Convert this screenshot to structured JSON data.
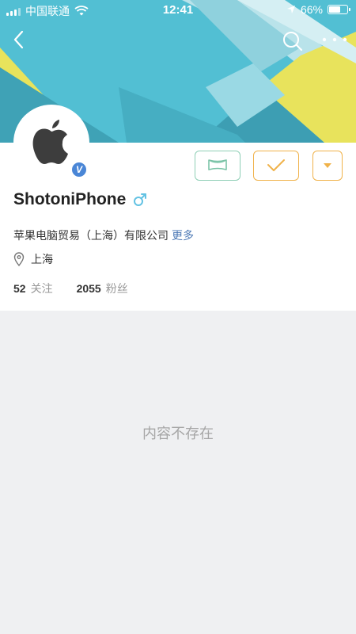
{
  "status_bar": {
    "carrier": "中国联通",
    "time": "12:41",
    "battery_percent_text": "66%",
    "battery_level": 0.66
  },
  "nav": {
    "back_icon": "chevron-left-icon",
    "search_icon": "search-icon",
    "more_icon": "more-dots-icon"
  },
  "profile": {
    "name": "ShotoniPhone",
    "gender": "male",
    "verified_badge": "V",
    "company": "苹果电脑贸易（上海）有限公司",
    "more_label": "更多",
    "location": "上海",
    "following_count": "52",
    "following_label": "关注",
    "followers_count": "2055",
    "followers_label": "粉丝"
  },
  "actions": {
    "message_icon": "message-icon",
    "follow_icon": "checkmark-icon",
    "dropdown_icon": "caret-down-icon"
  },
  "content": {
    "empty_message": "内容不存在"
  },
  "colors": {
    "banner_teal": "#4ab6c9",
    "banner_yellow": "#e8e35c",
    "verified_blue": "#4a86d6",
    "follow_orange": "#f0b24a",
    "message_green": "#8fcfb6",
    "link_blue": "#4d79b5",
    "gender_blue": "#63c2e3"
  }
}
